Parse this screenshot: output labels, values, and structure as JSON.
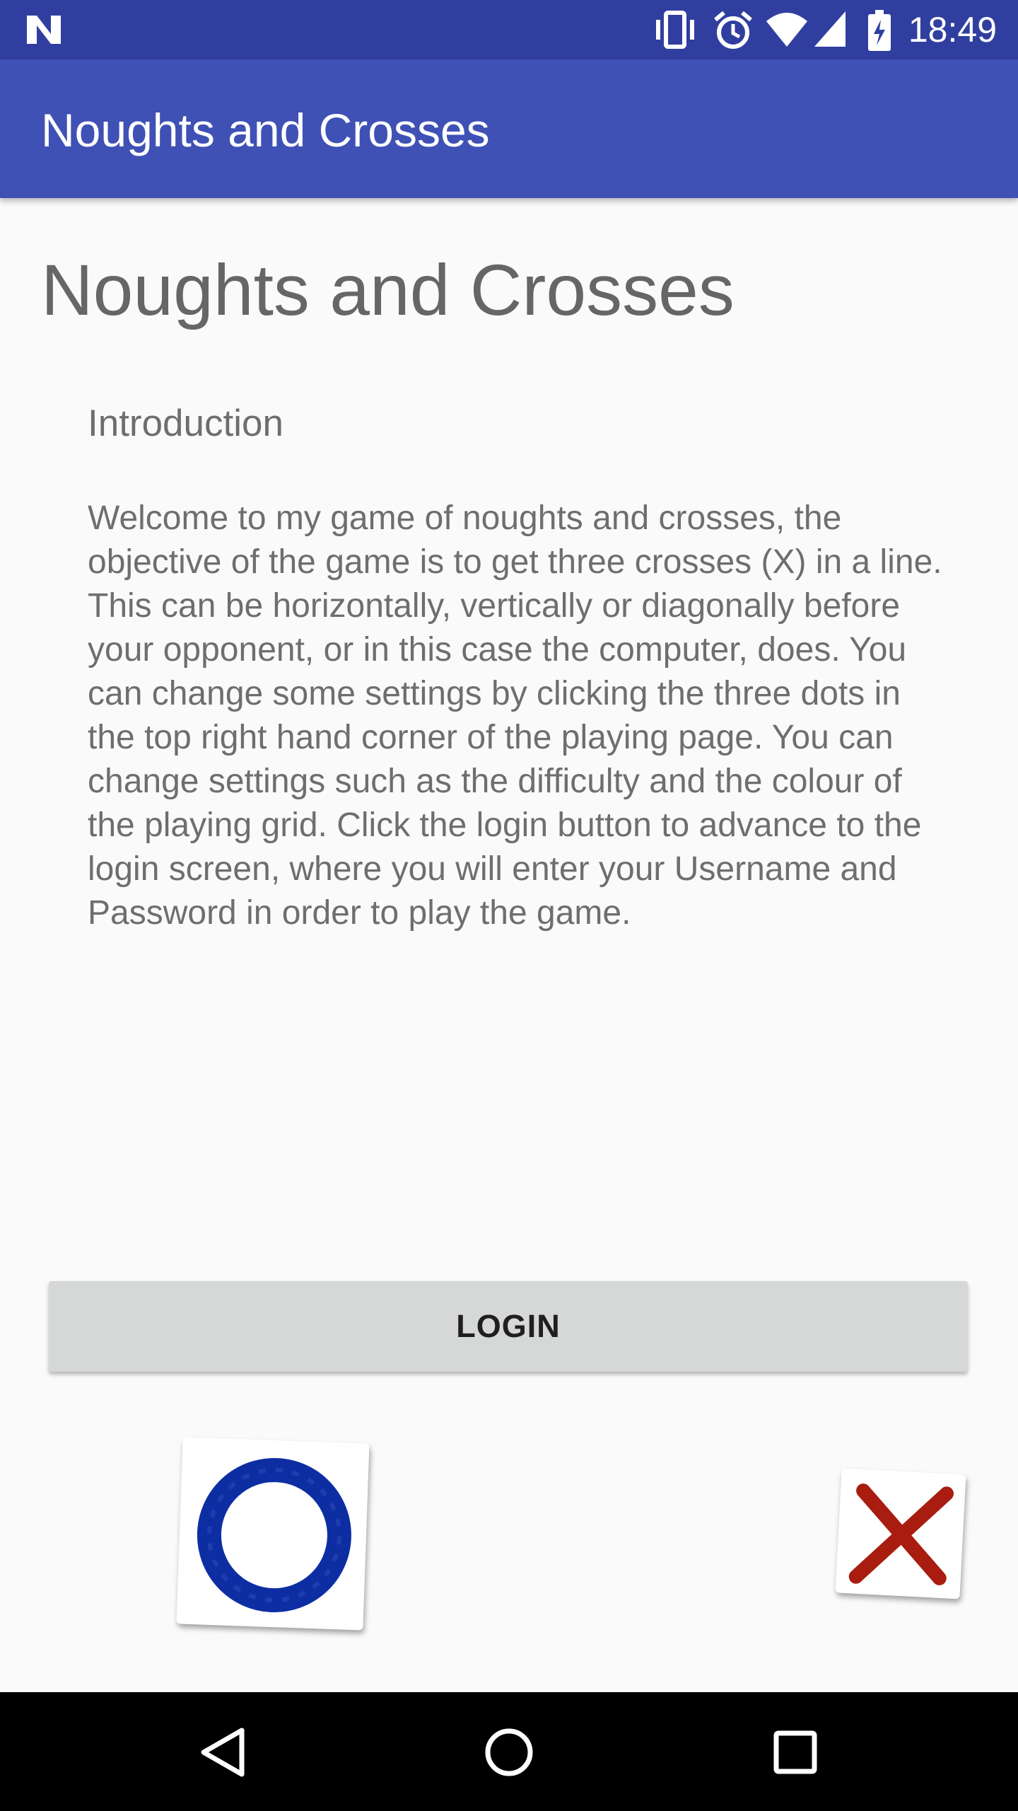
{
  "status_bar": {
    "time": "18:49",
    "icons": [
      "notification-n-icon",
      "vibrate-icon",
      "alarm-icon",
      "wifi-icon",
      "cell-signal-icon",
      "battery-charging-icon"
    ]
  },
  "app_bar": {
    "title": "Noughts and Crosses"
  },
  "main": {
    "heading": "Noughts and Crosses",
    "section_label": "Introduction",
    "intro_text": "Welcome to my game of noughts and crosses, the objective of the game is to get three crosses (X) in a line. This can be horizontally, vertically or diagonally before your opponent, or in this case the computer, does. You can change some settings by clicking the three dots in the top right hand corner of the playing page. You can change settings such as the difficulty and the colour of the playing grid. Click the login button to advance to the login screen, where you will enter your Username and Password in order to play the game.",
    "login_label": "LOGIN"
  },
  "decorations": {
    "nought_color": "#0d2ea3",
    "cross_color": "#a81d10"
  },
  "nav_bar": {
    "buttons": [
      "back-icon",
      "home-icon",
      "recents-icon"
    ]
  },
  "colors": {
    "primary": "#3f51b5",
    "primary_dark": "#303f9f",
    "background": "#fafafa"
  }
}
